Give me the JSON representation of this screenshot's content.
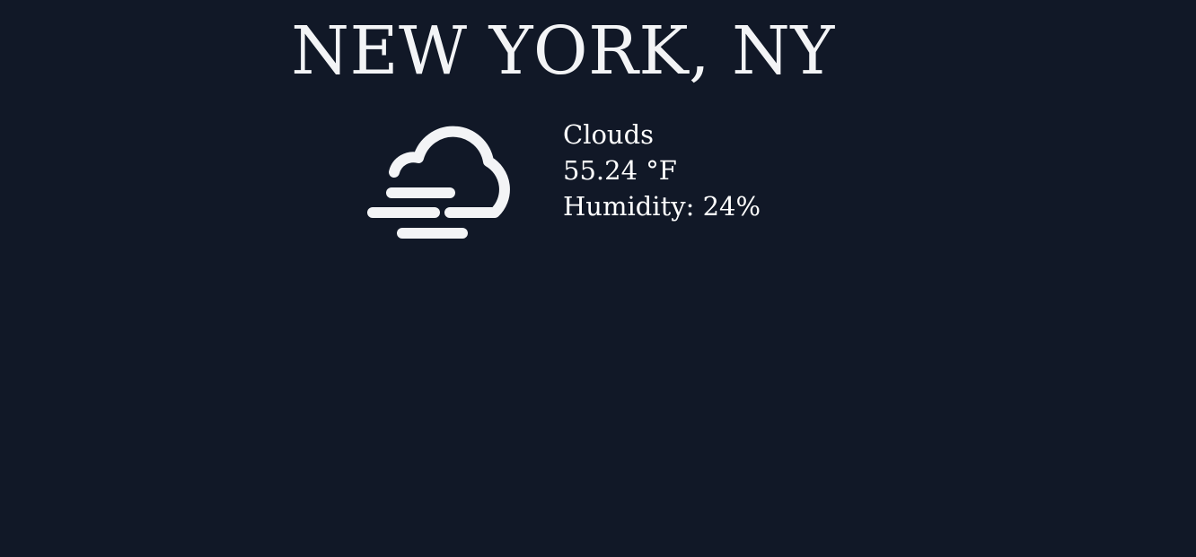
{
  "location": {
    "title": "NEW YORK, NY"
  },
  "weather": {
    "icon": "cloud-fog-icon",
    "condition": "Clouds",
    "temperature": "55.24 °F",
    "humidity": "Humidity: 24%"
  },
  "colors": {
    "background": "#111827",
    "text": "#f3f4f6"
  }
}
